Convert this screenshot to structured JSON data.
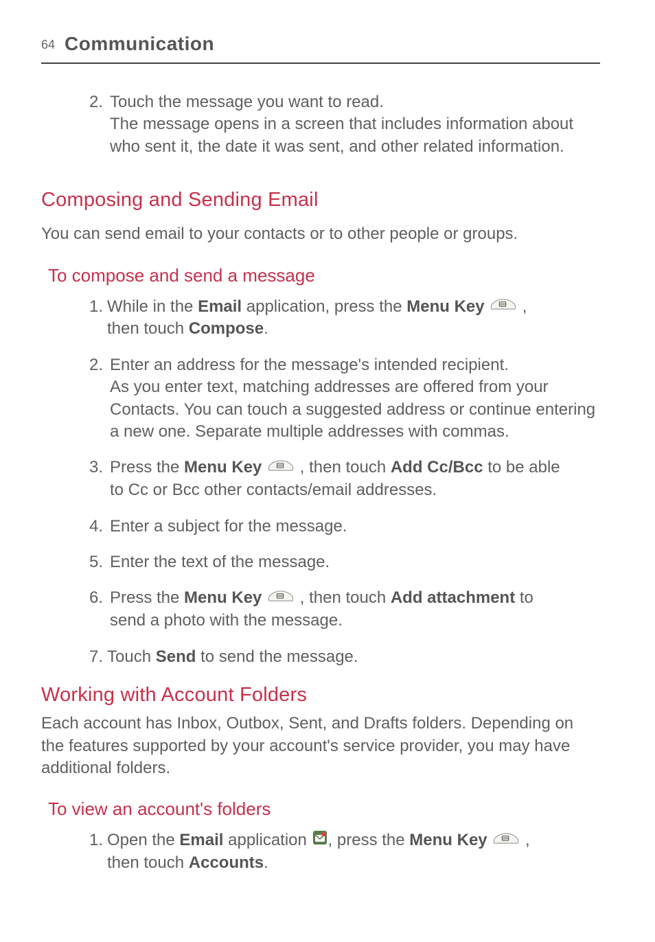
{
  "header": {
    "page_number": "64",
    "chapter": "Communication"
  },
  "intro": {
    "step2_num": "2.",
    "step2_line1": "Touch the message you want to read.",
    "step2_rest": "The message opens in a screen that includes information about who sent it, the date it was sent, and other related information."
  },
  "section1": {
    "title": "Composing and Sending Email",
    "intro": "You can send email to your contacts or to other people or groups.",
    "subhead": "To compose and send a message",
    "steps": {
      "s1": {
        "num": "1.",
        "pre": "While in the ",
        "email": "Email",
        "mid": " application, press the ",
        "menukey": "Menu Key",
        "post_icon": " ,",
        "line2_pre": "then touch ",
        "compose": "Compose",
        "line2_post": "."
      },
      "s2": {
        "num": "2.",
        "line1": "Enter an address for the message's intended recipient.",
        "rest": "As you enter text, matching addresses are offered from your Contacts. You can touch a suggested address or continue entering a new one. Separate multiple addresses with commas."
      },
      "s3": {
        "num": "3.",
        "pre": "Press the ",
        "menukey": "Menu Key",
        "mid": " , then touch ",
        "addcc": "Add Cc/Bcc",
        "post": " to be able",
        "line2": "to Cc or Bcc other contacts/email addresses."
      },
      "s4": {
        "num": "4.",
        "text": "Enter a subject for the message."
      },
      "s5": {
        "num": "5.",
        "text": "Enter the text of the message."
      },
      "s6": {
        "num": "6.",
        "pre": "Press the ",
        "menukey": "Menu Key",
        "mid": " , then touch ",
        "attach": "Add attachment",
        "post": " to",
        "line2": "send a photo with the message."
      },
      "s7": {
        "num": "7.",
        "pre": "Touch ",
        "send": "Send",
        "post": " to send the message."
      }
    }
  },
  "section2": {
    "title": "Working with Account Folders",
    "intro": "Each account has Inbox, Outbox, Sent, and Drafts folders. Depending on the features supported by your account's service provider, you may have additional folders.",
    "subhead": "To view an account's folders",
    "step1": {
      "num": "1.",
      "pre": "Open the ",
      "email": "Email",
      "mid1": " application ",
      "mid2": ", press the ",
      "menukey": "Menu Key",
      "post_icon": " ,",
      "line2_pre": "then touch ",
      "accounts": "Accounts",
      "line2_post": "."
    }
  }
}
